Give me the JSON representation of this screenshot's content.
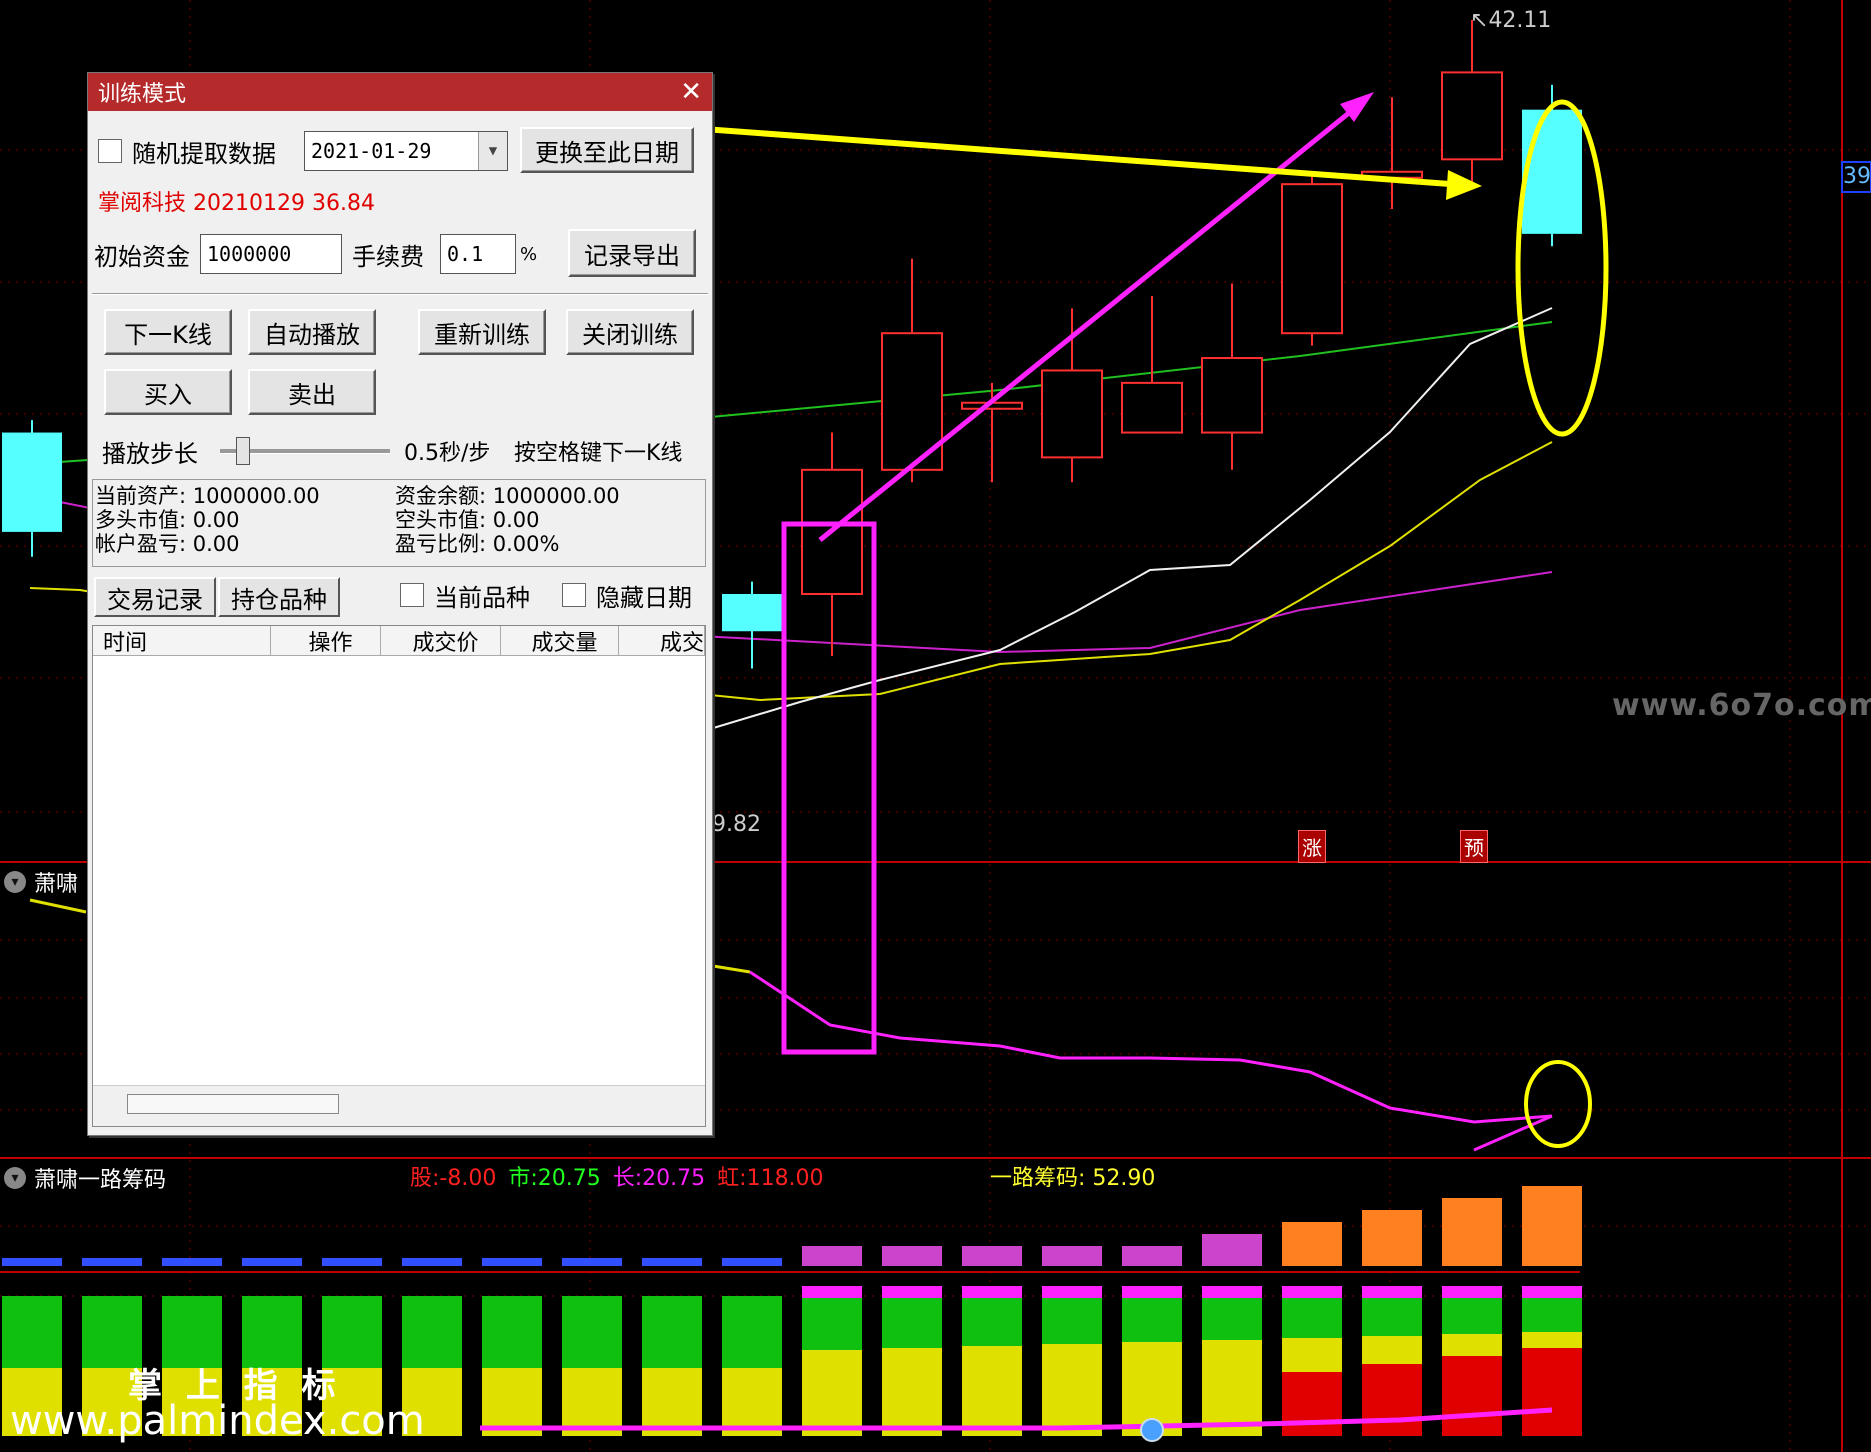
{
  "dialog": {
    "title": "训练模式",
    "random_data_label": "随机提取数据",
    "date_value": "2021-01-29",
    "change_date_button": "更换至此日期",
    "stock_info": "掌阅科技 20210129 36.84",
    "initial_capital_label": "初始资金",
    "initial_capital_value": "1000000",
    "fee_label": "手续费",
    "fee_value": "0.1",
    "fee_unit": "%",
    "export_button": "记录导出",
    "next_k_button": "下一K线",
    "autoplay_button": "自动播放",
    "retrain_button": "重新训练",
    "close_train_button": "关闭训练",
    "buy_button": "买入",
    "sell_button": "卖出",
    "step_label": "播放步长",
    "step_value": "0.5秒/步",
    "step_hint": "按空格键下一K线",
    "step_slider_value": 0.1,
    "stats": {
      "current_assets": "当前资产: 1000000.00",
      "cash_balance": "资金余额: 1000000.00",
      "long_value": "多头市值: 0.00",
      "short_value": "空头市值: 0.00",
      "account_pnl": "帐户盈亏: 0.00",
      "pnl_ratio": "盈亏比例: 0.00%"
    },
    "tabs": [
      "交易记录",
      "持仓品种"
    ],
    "current_symbol_label": "当前品种",
    "hide_date_label": "隐藏日期",
    "columns": [
      "时间",
      "操作",
      "成交价",
      "成交量",
      "成交"
    ]
  },
  "price_chart": {
    "high_label": "42.11",
    "low_label": "9.82",
    "right_axis_label": "39",
    "tag_zhang": "涨",
    "tag_yu": "预"
  },
  "panel2": {
    "title": "萧啸"
  },
  "panel3": {
    "title": "萧啸一路筹码",
    "values": [
      {
        "label": "股:",
        "value": "-8.00",
        "color": "#ff2020"
      },
      {
        "label": "市:",
        "value": "20.75",
        "color": "#20ff20"
      },
      {
        "label": "长:",
        "value": "20.75",
        "color": "#ff20ff"
      },
      {
        "label": "虹:",
        "value": "118.00",
        "color": "#ff2020"
      }
    ],
    "chips_label": "一路筹码:",
    "chips_value": "52.90"
  },
  "watermarks": {
    "site1": "www.6o7o.com",
    "cn": "掌 上 指 标",
    "site2": "www.palmindex.com"
  },
  "colors": {
    "up": "#ff3030",
    "down": "#55ffff",
    "highlight_yellow": "#ffff00",
    "highlight_magenta": "#ff22ff",
    "dialog_title": "#b52a2a"
  },
  "chart_data": {
    "type": "candlestick",
    "low": 9.82,
    "high": 42.11,
    "candles": [
      {
        "o": 25.5,
        "c": 21.5,
        "h": 26.0,
        "l": 20.5
      },
      {
        "o": 19.0,
        "c": 17.5,
        "h": 19.5,
        "l": 16.0
      },
      {
        "o": 19.0,
        "c": 24.0,
        "h": 25.5,
        "l": 16.5
      },
      {
        "o": 24.0,
        "c": 29.5,
        "h": 32.5,
        "l": 23.5
      },
      {
        "o": 26.7,
        "c": 26.7,
        "h": 27.5,
        "l": 23.5
      },
      {
        "o": 24.5,
        "c": 28.0,
        "h": 30.5,
        "l": 23.5
      },
      {
        "o": 25.5,
        "c": 27.5,
        "h": 31.0,
        "l": 25.5
      },
      {
        "o": 25.5,
        "c": 28.5,
        "h": 31.5,
        "l": 24.0
      },
      {
        "o": 29.5,
        "c": 35.5,
        "h": 36.0,
        "l": 29.0
      },
      {
        "o": 36.0,
        "c": 36.0,
        "h": 39.0,
        "l": 34.5
      },
      {
        "o": 36.5,
        "c": 40.0,
        "h": 42.11,
        "l": 35.5
      },
      {
        "o": 38.5,
        "c": 33.5,
        "h": 39.5,
        "l": 33.0
      }
    ]
  }
}
